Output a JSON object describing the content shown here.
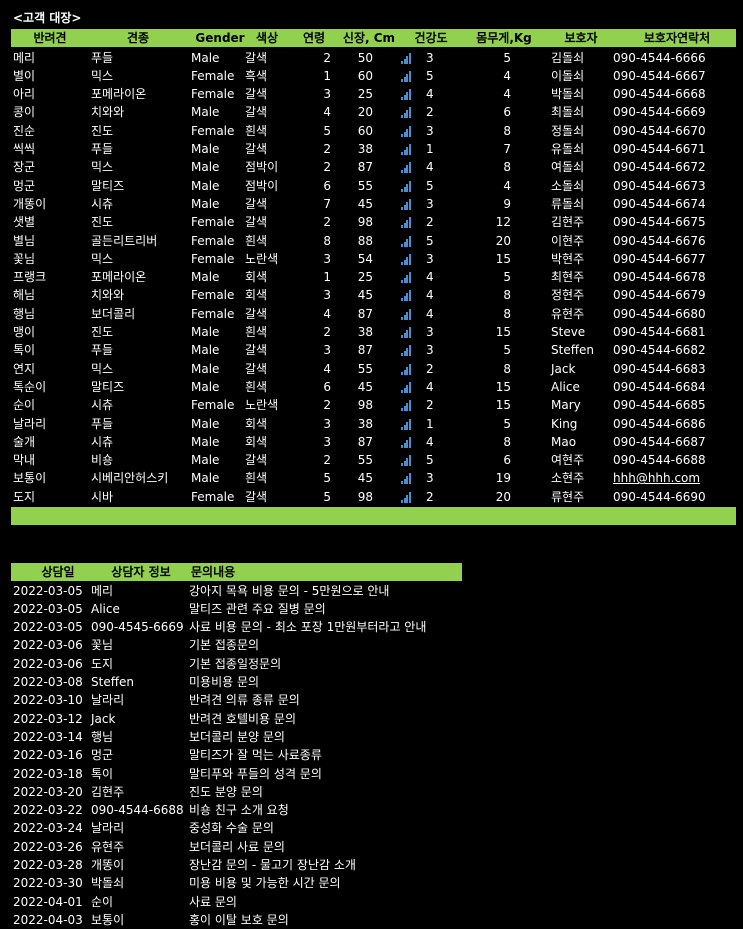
{
  "title": "<고객 대장>",
  "customers": {
    "headers": [
      "반려견",
      "견종",
      "Gender",
      "색상",
      "연령",
      "신장, Cm",
      "건강도",
      "몸무게,Kg",
      "보호자",
      "보호자연락처"
    ],
    "rows": [
      [
        "메리",
        "푸들",
        "Male",
        "갈색",
        "2",
        "50",
        "3",
        "5",
        "김돌쇠",
        "090-4544-6666"
      ],
      [
        "별이",
        "믹스",
        "Female",
        "흑색",
        "1",
        "60",
        "5",
        "4",
        "이돌쇠",
        "090-4544-6667"
      ],
      [
        "아리",
        "포메라이온",
        "Female",
        "갈색",
        "3",
        "25",
        "4",
        "4",
        "박돌쇠",
        "090-4544-6668"
      ],
      [
        "콩이",
        "치와와",
        "Male",
        "갈색",
        "4",
        "20",
        "2",
        "6",
        "최돌쇠",
        "090-4544-6669"
      ],
      [
        "진순",
        "진도",
        "Female",
        "흰색",
        "5",
        "60",
        "3",
        "8",
        "정돌쇠",
        "090-4544-6670"
      ],
      [
        "씩씩",
        "푸들",
        "Male",
        "갈색",
        "2",
        "38",
        "1",
        "7",
        "유돌쇠",
        "090-4544-6671"
      ],
      [
        "장군",
        "믹스",
        "Male",
        "점박이",
        "2",
        "87",
        "4",
        "8",
        "여돌쇠",
        "090-4544-6672"
      ],
      [
        "멍군",
        "말티즈",
        "Male",
        "점박이",
        "6",
        "55",
        "5",
        "4",
        "소돌쇠",
        "090-4544-6673"
      ],
      [
        "개똥이",
        "시츄",
        "Male",
        "갈색",
        "7",
        "45",
        "3",
        "9",
        "류돌쇠",
        "090-4544-6674"
      ],
      [
        "샛별",
        "진도",
        "Female",
        "갈색",
        "2",
        "98",
        "2",
        "12",
        "김현주",
        "090-4544-6675"
      ],
      [
        "별님",
        "골든리트리버",
        "Female",
        "흰색",
        "8",
        "88",
        "5",
        "20",
        "이현주",
        "090-4544-6676"
      ],
      [
        "꽃님",
        "믹스",
        "Female",
        "노란색",
        "3",
        "54",
        "3",
        "15",
        "박현주",
        "090-4544-6677"
      ],
      [
        "프랭크",
        "포메라이온",
        "Male",
        "회색",
        "1",
        "25",
        "4",
        "5",
        "최현주",
        "090-4544-6678"
      ],
      [
        "해님",
        "치와와",
        "Female",
        "회색",
        "3",
        "45",
        "4",
        "8",
        "정현주",
        "090-4544-6679"
      ],
      [
        "행님",
        "보더콜리",
        "Female",
        "갈색",
        "4",
        "87",
        "4",
        "8",
        "유현주",
        "090-4544-6680"
      ],
      [
        "맹이",
        "진도",
        "Male",
        "흰색",
        "2",
        "38",
        "3",
        "15",
        "Steve",
        "090-4544-6681"
      ],
      [
        "톡이",
        "푸들",
        "Male",
        "갈색",
        "3",
        "87",
        "3",
        "5",
        "Steffen",
        "090-4544-6682"
      ],
      [
        "연지",
        "믹스",
        "Male",
        "갈색",
        "4",
        "55",
        "2",
        "8",
        "Jack",
        "090-4544-6683"
      ],
      [
        "톡순이",
        "말티즈",
        "Male",
        "흰색",
        "6",
        "45",
        "4",
        "15",
        "Alice",
        "090-4544-6684"
      ],
      [
        "순이",
        "시츄",
        "Female",
        "노란색",
        "2",
        "98",
        "2",
        "15",
        "Mary",
        "090-4544-6685"
      ],
      [
        "날라리",
        "푸들",
        "Male",
        "회색",
        "3",
        "38",
        "1",
        "5",
        "King",
        "090-4544-6686"
      ],
      [
        "술개",
        "시츄",
        "Male",
        "회색",
        "3",
        "87",
        "4",
        "8",
        "Mao",
        "090-4544-6687"
      ],
      [
        "막내",
        "비숑",
        "Male",
        "갈색",
        "2",
        "55",
        "5",
        "6",
        "여현주",
        "090-4544-6688"
      ],
      [
        "보통이",
        "시베리안허스키",
        "Male",
        "흰색",
        "5",
        "45",
        "3",
        "19",
        "소현주",
        "hhh@hhh.com"
      ],
      [
        "도지",
        "시바",
        "Female",
        "갈색",
        "5",
        "98",
        "2",
        "20",
        "류현주",
        "090-4544-6690"
      ]
    ]
  },
  "consultations": {
    "headers": [
      "상담일",
      "상담자 정보",
      "문의내용"
    ],
    "rows": [
      [
        "2022-03-05",
        "메리",
        "강아지 목욕 비용 문의 - 5만원으로 안내"
      ],
      [
        "2022-03-05",
        "Alice",
        "말티즈 관련 주요 질병 문의"
      ],
      [
        "2022-03-05",
        "090-4545-6669",
        "사료 비용 문의 - 최소 포장 1만원부터라고 안내"
      ],
      [
        "2022-03-06",
        "꽃님",
        "기본 접종문의"
      ],
      [
        "2022-03-06",
        "도지",
        "기본 접종일정문의"
      ],
      [
        "2022-03-08",
        "Steffen",
        "미용비용 문의"
      ],
      [
        "2022-03-10",
        "날라리",
        "반려견 의류 종류 문의"
      ],
      [
        "2022-03-12",
        "Jack",
        "반려견 호텔비용 문의"
      ],
      [
        "2022-03-14",
        "행님",
        "보더콜리 분양 문의"
      ],
      [
        "2022-03-16",
        "멍군",
        "말티즈가 잘 먹는 사료종류"
      ],
      [
        "2022-03-18",
        "톡이",
        "말티푸와 푸들의 성격 문의"
      ],
      [
        "2022-03-20",
        "김현주",
        "진도 분양 문의"
      ],
      [
        "2022-03-22",
        "090-4544-6688",
        "비숑 친구 소개 요청"
      ],
      [
        "2022-03-24",
        "날라리",
        "중성화 수술 문의"
      ],
      [
        "2022-03-26",
        "유현주",
        "보더콜리 사료 문의"
      ],
      [
        "2022-03-28",
        "개똥이",
        "장난감 문의 - 물고기 장난감 소개"
      ],
      [
        "2022-03-30",
        "박돌쇠",
        "미용 비용 및 가능한 시간 문의"
      ],
      [
        "2022-04-01",
        "순이",
        "사료 문의"
      ],
      [
        "2022-04-03",
        "보통이",
        "홍이 이탈 보호 문의"
      ]
    ]
  },
  "colors": {
    "header_bg": "#92d050",
    "background": "#000000",
    "text": "#ffffff",
    "bar_icon": "#4a8fd6"
  },
  "icons": {
    "health": "signal-bars-icon"
  }
}
